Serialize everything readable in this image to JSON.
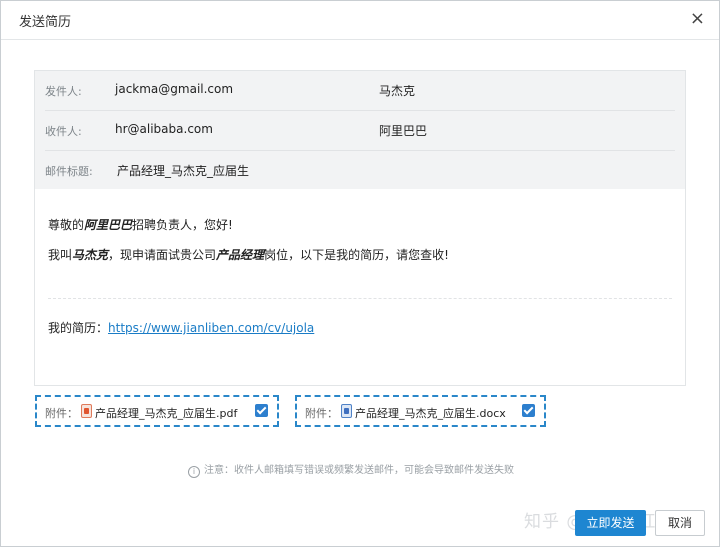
{
  "dialog": {
    "title": "发送简历",
    "close_glyph": "×"
  },
  "header": {
    "sender": {
      "label": "发件人:",
      "email": "jackma@gmail.com",
      "name": "马杰克"
    },
    "recipient": {
      "label": "收件人:",
      "email": "hr@alibaba.com",
      "name": "阿里巴巴"
    },
    "subject": {
      "label": "邮件标题:",
      "value": "产品经理_马杰克_应届生"
    }
  },
  "body": {
    "greeting_pre": "尊敬的",
    "greeting_company": "阿里巴巴",
    "greeting_post": "招聘负责人，您好!",
    "intro_pre": "我叫",
    "intro_name": "马杰克",
    "intro_mid": "，现申请面试贵公司",
    "intro_position": "产品经理",
    "intro_post": "岗位，以下是我的简历，请您查收!",
    "resume_label": "我的简历：",
    "resume_link": "https://www.jianliben.com/cv/ujola"
  },
  "attachments": [
    {
      "label": "附件：",
      "icon": "pdf-file-icon",
      "filename": "产品经理_马杰克_应届生.pdf",
      "checked": true
    },
    {
      "label": "附件：",
      "icon": "word-file-icon",
      "filename": "产品经理_马杰克_应届生.docx",
      "checked": true
    }
  ],
  "note": {
    "icon_glyph": "i",
    "text": "注意：收件人邮箱填写错误或频繁发送邮件，可能会导致邮件发送失败"
  },
  "watermark": "知乎 @求职小红本",
  "buttons": {
    "send": "立即发送",
    "cancel": "取消"
  },
  "colors": {
    "accent": "#1e86d1",
    "link": "#1a7cc6",
    "dashed_border": "#2a87c9"
  }
}
